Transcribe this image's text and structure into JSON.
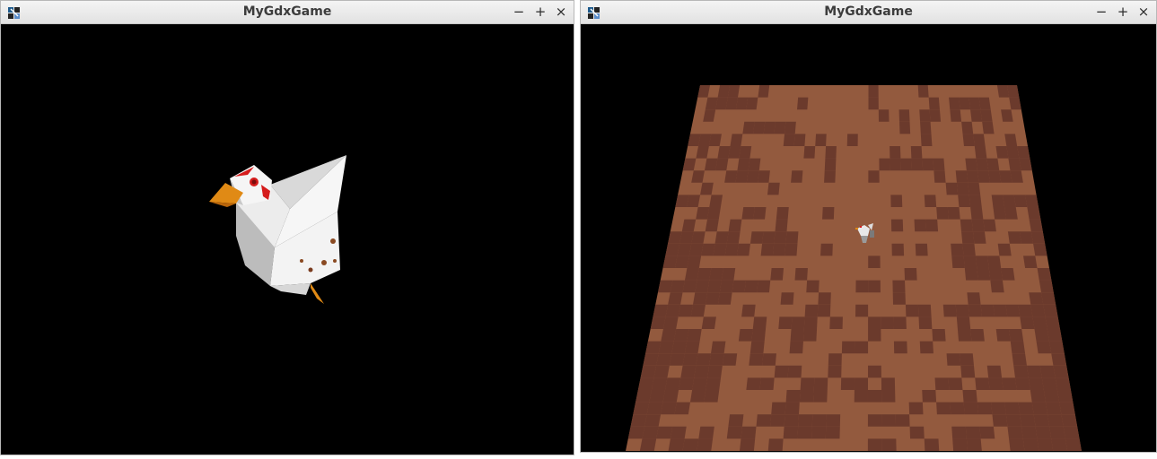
{
  "windows": [
    {
      "title": "MyGdxGame",
      "controls": {
        "minimize": "−",
        "maximize": "+",
        "close": "×"
      },
      "icon": "java-app-icon",
      "scene": "close-up of a low-poly white chicken model on black background"
    },
    {
      "title": "MyGdxGame",
      "controls": {
        "minimize": "−",
        "maximize": "+",
        "close": "×"
      },
      "icon": "java-app-icon",
      "scene": "top-down perspective dirt tile terrain with small chicken in center"
    }
  ],
  "colors": {
    "titlebar": "#e9e9e9",
    "viewport_background": "#000000",
    "dirt_light": "#935a3e",
    "dirt_dark": "#6b3a2c",
    "chicken_white": "#efefef",
    "beak_orange": "#e08a15",
    "comb_red": "#d51c1c"
  }
}
